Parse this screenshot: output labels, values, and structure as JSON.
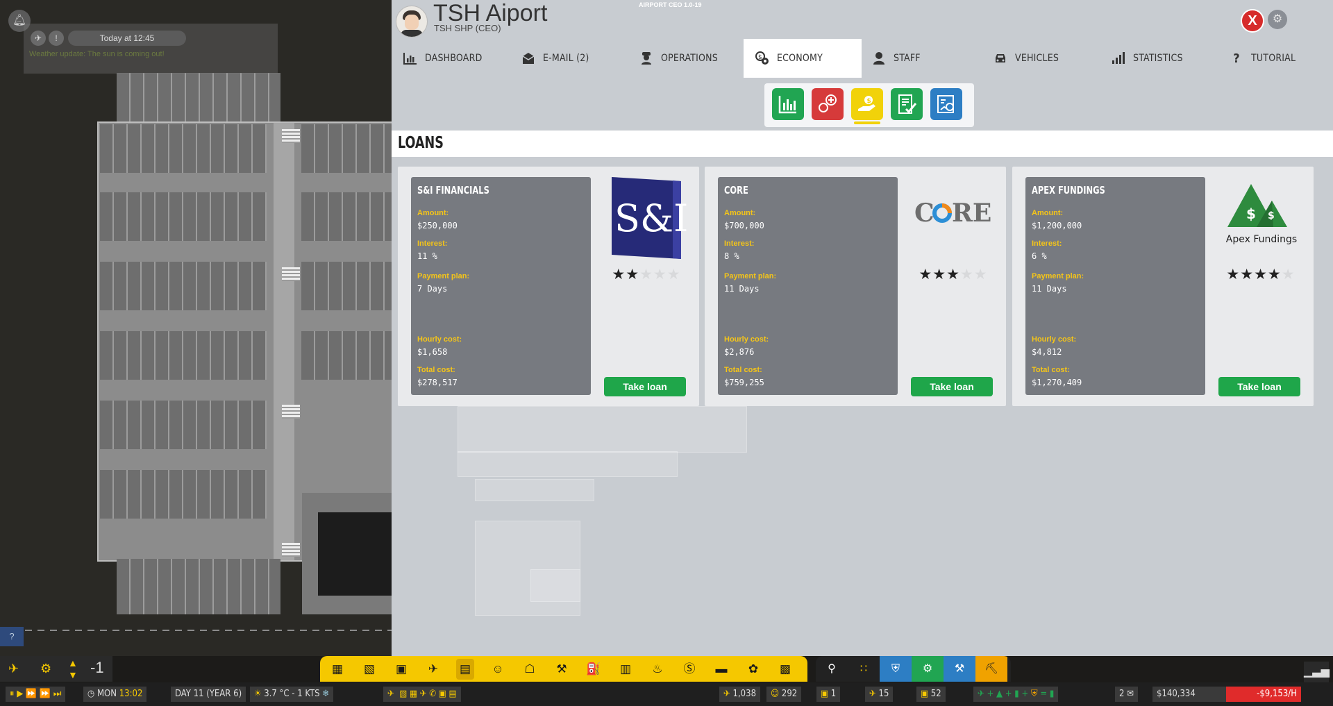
{
  "notification": {
    "time": "Today at 12:45",
    "message": "Weather update: The sun is coming out!"
  },
  "header": {
    "title": "TSH Aiport",
    "subtitle": "TSH SHP (CEO)",
    "version": "AIRPORT CEO 1.0-19"
  },
  "tabs": [
    {
      "label": "DASHBOARD",
      "icon": "bar-chart-icon"
    },
    {
      "label": "E-MAIL (2)",
      "icon": "envelope-icon"
    },
    {
      "label": "OPERATIONS",
      "icon": "operator-icon"
    },
    {
      "label": "ECONOMY",
      "icon": "money-gear-icon",
      "active": true
    },
    {
      "label": "STAFF",
      "icon": "person-icon"
    },
    {
      "label": "VEHICLES",
      "icon": "car-icon"
    },
    {
      "label": "STATISTICS",
      "icon": "stats-icon"
    },
    {
      "label": "TUTORIAL",
      "icon": "question-icon"
    }
  ],
  "sub_buttons": [
    {
      "name": "economy-overview",
      "color": "#21a552"
    },
    {
      "name": "economy-expenses",
      "color": "#d63a3a"
    },
    {
      "name": "economy-loans",
      "color": "#f1d20a",
      "active": true
    },
    {
      "name": "economy-contracts",
      "color": "#21a552"
    },
    {
      "name": "economy-reports",
      "color": "#2d7ec4"
    }
  ],
  "section_title": "LOANS",
  "loan_labels": {
    "amount": "Amount:",
    "interest": "Interest:",
    "payment_plan": "Payment plan:",
    "hourly_cost": "Hourly cost:",
    "total_cost": "Total cost:",
    "take_loan": "Take loan"
  },
  "loans": [
    {
      "name": "S&I FINANCIALS",
      "amount": "$250,000",
      "interest": "11 %",
      "payment_plan": "7 Days",
      "hourly_cost": "$1,658",
      "total_cost": "$278,517",
      "rating": 2,
      "logo_text": "S&I"
    },
    {
      "name": "CORE",
      "amount": "$700,000",
      "interest": "8 %",
      "payment_plan": "11 Days",
      "hourly_cost": "$2,876",
      "total_cost": "$759,255",
      "rating": 3,
      "logo_text": "CORE"
    },
    {
      "name": "APEX FUNDINGS",
      "amount": "$1,200,000",
      "interest": "6 %",
      "payment_plan": "11 Days",
      "hourly_cost": "$4,812",
      "total_cost": "$1,270,409",
      "rating": 4,
      "logo_text": "Apex Fundings"
    }
  ],
  "status_bar": {
    "day": "MON",
    "time": "13:02",
    "date": "DAY 11 (YEAR 6)",
    "weather": "3.7 °C - 1 KTS",
    "passengers": "1,038",
    "staff": "292",
    "stat_a": "1",
    "flights": "15",
    "vehicles": "52",
    "emails": "2",
    "balance": "$140,334",
    "rate": "-$9,153/H",
    "speed_level": "-1"
  }
}
